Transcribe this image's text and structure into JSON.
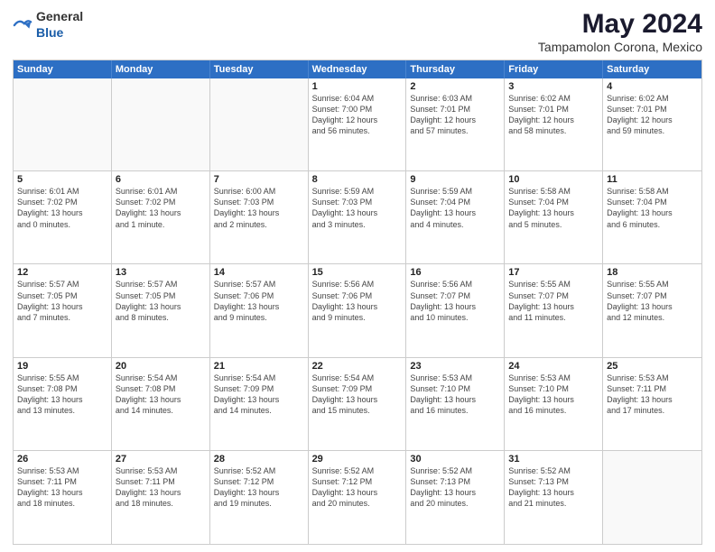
{
  "logo": {
    "general": "General",
    "blue": "Blue"
  },
  "title": "May 2024",
  "subtitle": "Tampamolon Corona, Mexico",
  "days": [
    "Sunday",
    "Monday",
    "Tuesday",
    "Wednesday",
    "Thursday",
    "Friday",
    "Saturday"
  ],
  "weeks": [
    [
      {
        "day": "",
        "info": ""
      },
      {
        "day": "",
        "info": ""
      },
      {
        "day": "",
        "info": ""
      },
      {
        "day": "1",
        "info": "Sunrise: 6:04 AM\nSunset: 7:00 PM\nDaylight: 12 hours\nand 56 minutes."
      },
      {
        "day": "2",
        "info": "Sunrise: 6:03 AM\nSunset: 7:01 PM\nDaylight: 12 hours\nand 57 minutes."
      },
      {
        "day": "3",
        "info": "Sunrise: 6:02 AM\nSunset: 7:01 PM\nDaylight: 12 hours\nand 58 minutes."
      },
      {
        "day": "4",
        "info": "Sunrise: 6:02 AM\nSunset: 7:01 PM\nDaylight: 12 hours\nand 59 minutes."
      }
    ],
    [
      {
        "day": "5",
        "info": "Sunrise: 6:01 AM\nSunset: 7:02 PM\nDaylight: 13 hours\nand 0 minutes."
      },
      {
        "day": "6",
        "info": "Sunrise: 6:01 AM\nSunset: 7:02 PM\nDaylight: 13 hours\nand 1 minute."
      },
      {
        "day": "7",
        "info": "Sunrise: 6:00 AM\nSunset: 7:03 PM\nDaylight: 13 hours\nand 2 minutes."
      },
      {
        "day": "8",
        "info": "Sunrise: 5:59 AM\nSunset: 7:03 PM\nDaylight: 13 hours\nand 3 minutes."
      },
      {
        "day": "9",
        "info": "Sunrise: 5:59 AM\nSunset: 7:04 PM\nDaylight: 13 hours\nand 4 minutes."
      },
      {
        "day": "10",
        "info": "Sunrise: 5:58 AM\nSunset: 7:04 PM\nDaylight: 13 hours\nand 5 minutes."
      },
      {
        "day": "11",
        "info": "Sunrise: 5:58 AM\nSunset: 7:04 PM\nDaylight: 13 hours\nand 6 minutes."
      }
    ],
    [
      {
        "day": "12",
        "info": "Sunrise: 5:57 AM\nSunset: 7:05 PM\nDaylight: 13 hours\nand 7 minutes."
      },
      {
        "day": "13",
        "info": "Sunrise: 5:57 AM\nSunset: 7:05 PM\nDaylight: 13 hours\nand 8 minutes."
      },
      {
        "day": "14",
        "info": "Sunrise: 5:57 AM\nSunset: 7:06 PM\nDaylight: 13 hours\nand 9 minutes."
      },
      {
        "day": "15",
        "info": "Sunrise: 5:56 AM\nSunset: 7:06 PM\nDaylight: 13 hours\nand 9 minutes."
      },
      {
        "day": "16",
        "info": "Sunrise: 5:56 AM\nSunset: 7:07 PM\nDaylight: 13 hours\nand 10 minutes."
      },
      {
        "day": "17",
        "info": "Sunrise: 5:55 AM\nSunset: 7:07 PM\nDaylight: 13 hours\nand 11 minutes."
      },
      {
        "day": "18",
        "info": "Sunrise: 5:55 AM\nSunset: 7:07 PM\nDaylight: 13 hours\nand 12 minutes."
      }
    ],
    [
      {
        "day": "19",
        "info": "Sunrise: 5:55 AM\nSunset: 7:08 PM\nDaylight: 13 hours\nand 13 minutes."
      },
      {
        "day": "20",
        "info": "Sunrise: 5:54 AM\nSunset: 7:08 PM\nDaylight: 13 hours\nand 14 minutes."
      },
      {
        "day": "21",
        "info": "Sunrise: 5:54 AM\nSunset: 7:09 PM\nDaylight: 13 hours\nand 14 minutes."
      },
      {
        "day": "22",
        "info": "Sunrise: 5:54 AM\nSunset: 7:09 PM\nDaylight: 13 hours\nand 15 minutes."
      },
      {
        "day": "23",
        "info": "Sunrise: 5:53 AM\nSunset: 7:10 PM\nDaylight: 13 hours\nand 16 minutes."
      },
      {
        "day": "24",
        "info": "Sunrise: 5:53 AM\nSunset: 7:10 PM\nDaylight: 13 hours\nand 16 minutes."
      },
      {
        "day": "25",
        "info": "Sunrise: 5:53 AM\nSunset: 7:11 PM\nDaylight: 13 hours\nand 17 minutes."
      }
    ],
    [
      {
        "day": "26",
        "info": "Sunrise: 5:53 AM\nSunset: 7:11 PM\nDaylight: 13 hours\nand 18 minutes."
      },
      {
        "day": "27",
        "info": "Sunrise: 5:53 AM\nSunset: 7:11 PM\nDaylight: 13 hours\nand 18 minutes."
      },
      {
        "day": "28",
        "info": "Sunrise: 5:52 AM\nSunset: 7:12 PM\nDaylight: 13 hours\nand 19 minutes."
      },
      {
        "day": "29",
        "info": "Sunrise: 5:52 AM\nSunset: 7:12 PM\nDaylight: 13 hours\nand 20 minutes."
      },
      {
        "day": "30",
        "info": "Sunrise: 5:52 AM\nSunset: 7:13 PM\nDaylight: 13 hours\nand 20 minutes."
      },
      {
        "day": "31",
        "info": "Sunrise: 5:52 AM\nSunset: 7:13 PM\nDaylight: 13 hours\nand 21 minutes."
      },
      {
        "day": "",
        "info": ""
      }
    ]
  ]
}
